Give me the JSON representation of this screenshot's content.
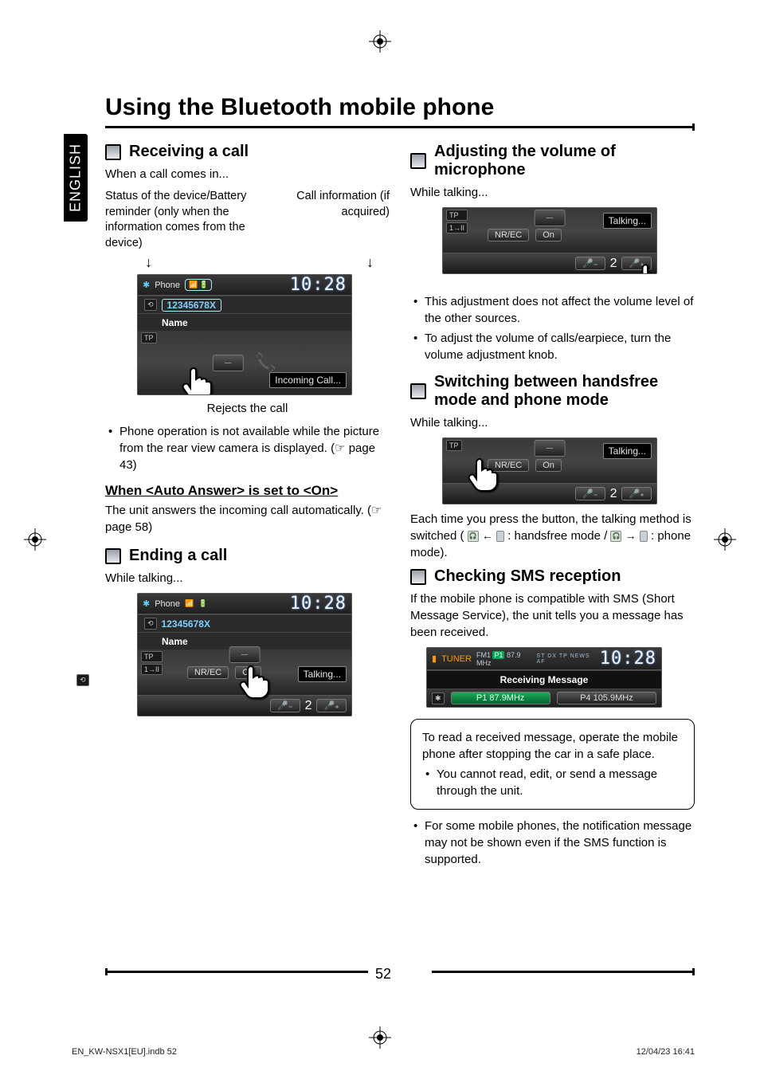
{
  "language_tab": "ENGLISH",
  "main_title": "Using the Bluetooth mobile phone",
  "page_number": "52",
  "footer": {
    "left": "EN_KW-NSX1[EU].indb   52",
    "right": "12/04/23   16:41"
  },
  "left": {
    "sec1": {
      "title": "Receiving a call",
      "intro": "When a call comes in...",
      "annot_left": "Status of the device/Battery reminder (only when the information comes from the device)",
      "annot_right": "Call information (if acquired)",
      "scr": {
        "top_label": "Phone",
        "clock": "10:28",
        "number": "12345678X",
        "name": "Name",
        "badge_tp": "TP",
        "status": "Incoming Call..."
      },
      "caption": "Rejects the call",
      "bullet1": "Phone operation is not available while the picture from the rear view camera is displayed. (☞ page 43)",
      "sub_heading": "When <Auto Answer> is set to <On>",
      "sub_body": "The unit answers the incoming call automatically. (☞ page 58)"
    },
    "sec2": {
      "title": "Ending a call",
      "intro": "While talking...",
      "scr": {
        "top_label": "Phone",
        "clock": "10:28",
        "number": "12345678X",
        "name": "Name",
        "badge_tp": "TP",
        "mode": "1→II",
        "nrec": "NR/EC",
        "on": "On",
        "status": "Talking...",
        "vol": "2"
      }
    }
  },
  "right": {
    "sec1": {
      "title": "Adjusting the volume of microphone",
      "intro": "While talking...",
      "scr": {
        "badge_tp": "TP",
        "mode": "1→II",
        "nrec": "NR/EC",
        "on": "On",
        "status": "Talking...",
        "vol": "2"
      },
      "bullet1": "This adjustment does not affect the volume level of the other sources.",
      "bullet2": "To adjust the volume of calls/earpiece, turn the volume adjustment knob."
    },
    "sec2": {
      "title": "Switching between handsfree mode and phone mode",
      "intro": "While talking...",
      "scr": {
        "badge_tp": "TP",
        "nrec": "NR/EC",
        "on": "On",
        "status": "Talking...",
        "vol": "2"
      },
      "body_a": "Each time you press the button, the talking method is switched (",
      "hf_label": " : handsfree mode / ",
      "pm_label": " : phone mode)."
    },
    "sec3": {
      "title": "Checking SMS reception",
      "intro": "If the mobile phone is compatible with SMS (Short Message Service), the unit tells you a message has been received.",
      "scr": {
        "top_label": "TUNER",
        "band": "FM1",
        "preset": "P1",
        "freq_top": "87.9 MHz",
        "indicators": "ST   DX   TP   NEWS   AF",
        "clock": "10:28",
        "msg": "Receiving Message",
        "p1": "P1 87.9MHz",
        "p4": "P4 105.9MHz"
      },
      "note": {
        "line1": "To read a received message, operate the mobile phone after stopping the car in a safe place.",
        "bullet1": "You cannot read, edit, or send a message through the unit."
      },
      "bullet_after": "For some mobile phones, the notification message may not be shown even if the SMS function is supported."
    }
  }
}
